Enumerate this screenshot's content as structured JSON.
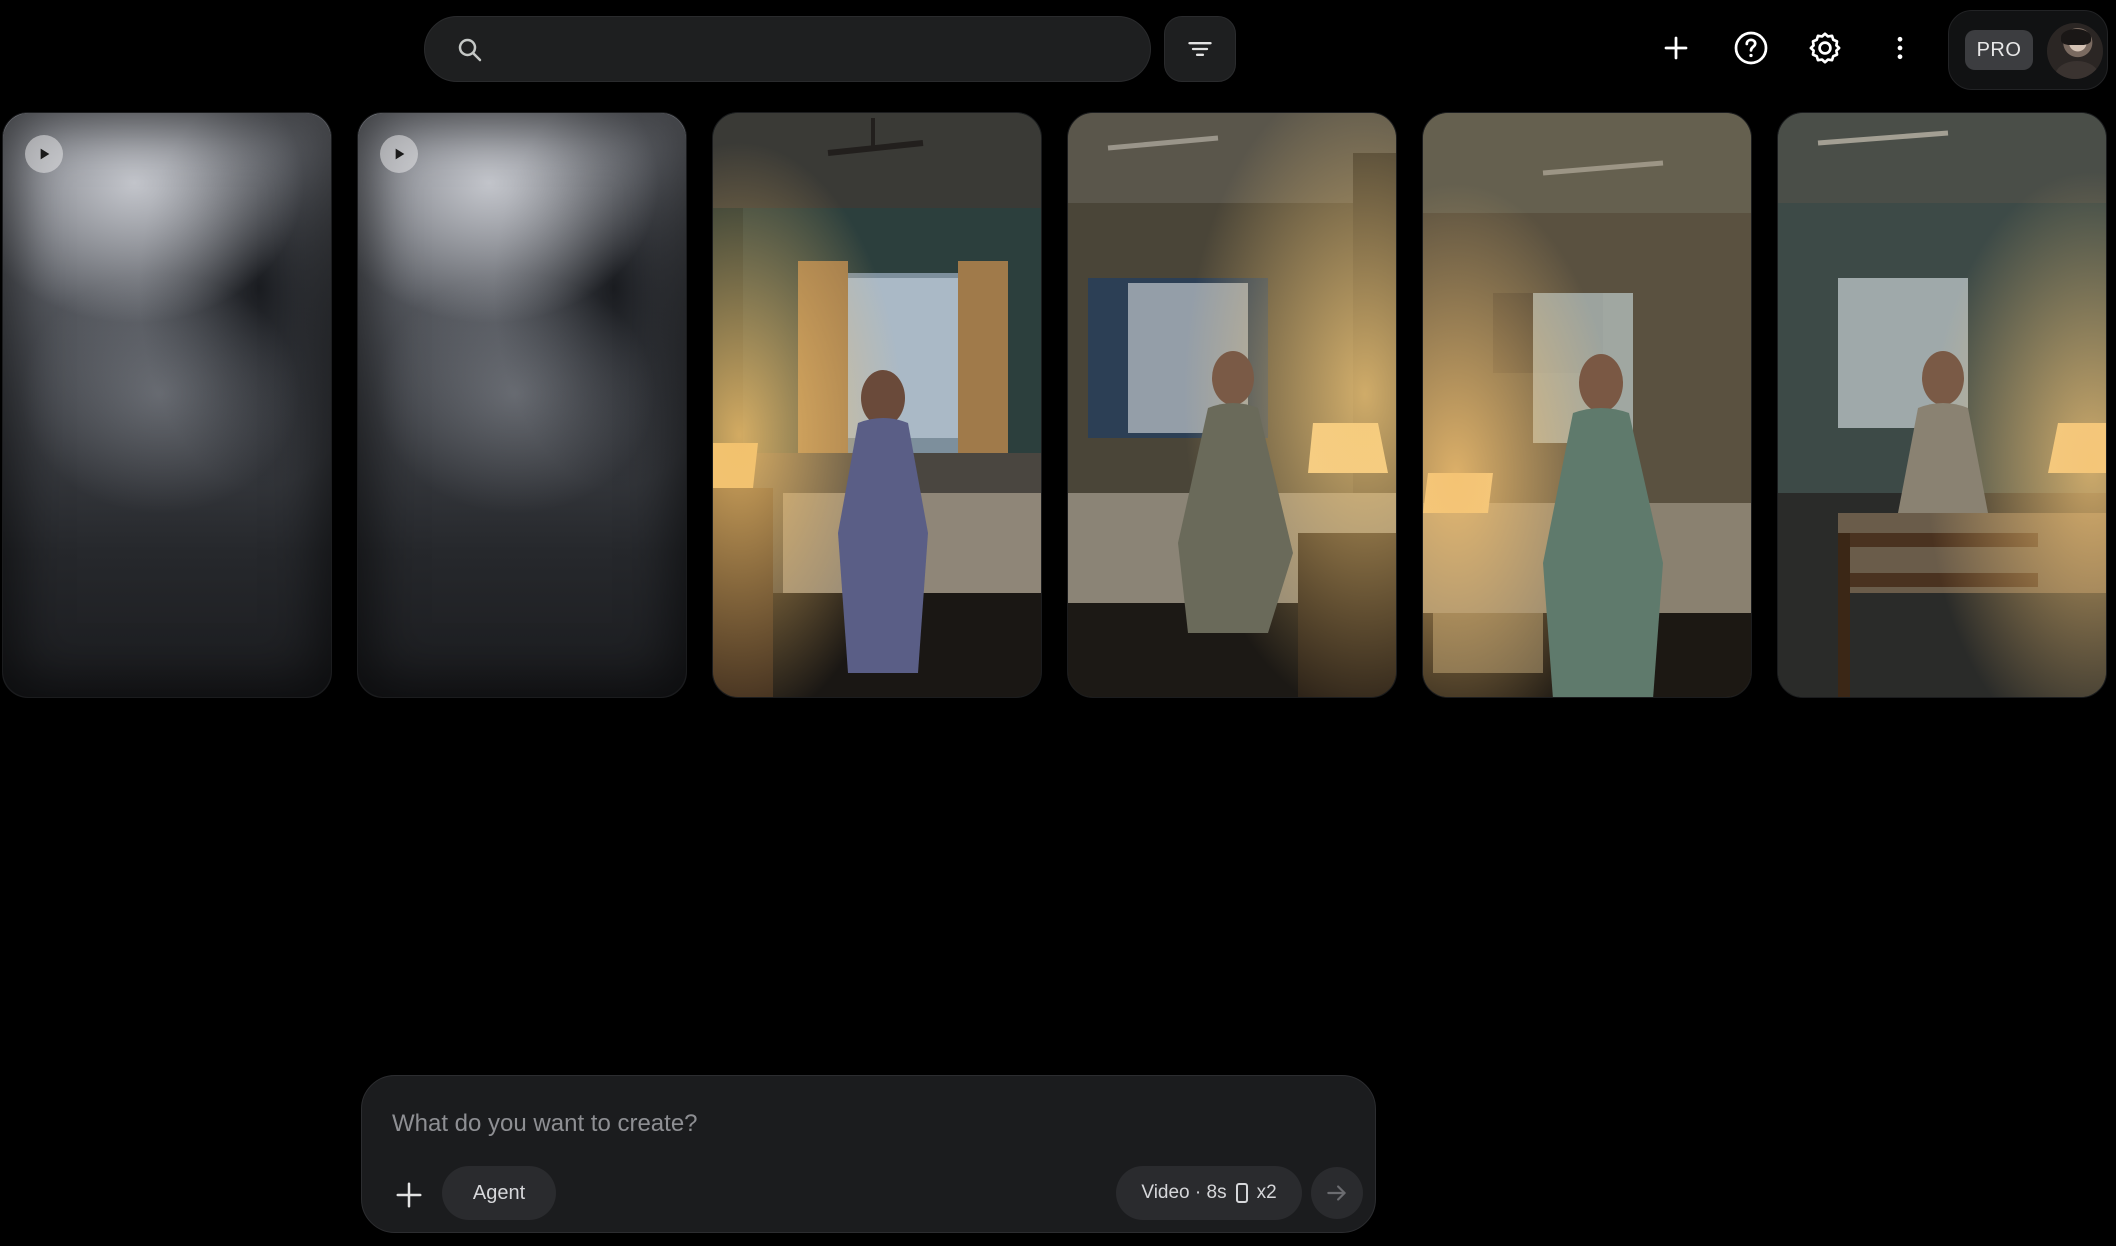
{
  "topbar": {
    "search": {
      "placeholder": "",
      "value": ""
    },
    "icons": {
      "search": "search-icon",
      "filter": "filter-icon",
      "add": "plus-icon",
      "help": "help-circle-icon",
      "settings": "gear-icon",
      "more": "more-vertical-icon"
    },
    "account": {
      "badge": "PRO",
      "avatar": "avatar"
    }
  },
  "gallery": {
    "items": [
      {
        "type": "video",
        "state": "generating"
      },
      {
        "type": "video",
        "state": "generating"
      },
      {
        "type": "image",
        "subject": "woman in blue kurta seated on bed beside lit lamp"
      },
      {
        "type": "image",
        "subject": "woman in patterned kurta seated on bed by window and lamp"
      },
      {
        "type": "image",
        "subject": "woman in green kurta seated on bed edge with lamp"
      },
      {
        "type": "image",
        "subject": "woman seated on wooden bed by window"
      }
    ]
  },
  "composer": {
    "prompt_placeholder": "What do you want to create?",
    "agent_label": "Agent",
    "mode_label": "Video · 8s",
    "count_label": "x2"
  },
  "colors": {
    "background": "#000000",
    "surface": "#1e1f20",
    "chip": "#2a2b2e",
    "text": "#e3e3e3",
    "muted_text": "#8e8f93"
  }
}
